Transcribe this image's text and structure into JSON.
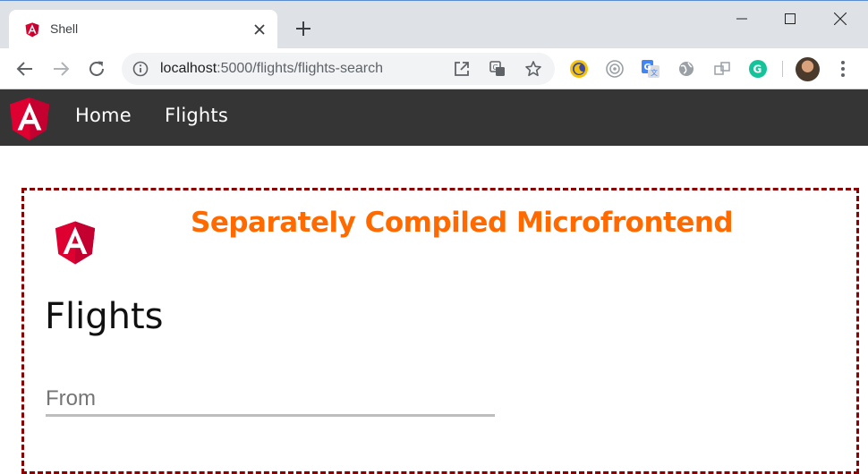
{
  "browser": {
    "tab": {
      "title": "Shell",
      "favicon": "angular-icon"
    },
    "new_tab_icon": "plus-icon",
    "window_controls": [
      "minimize-icon",
      "maximize-icon",
      "close-icon"
    ],
    "toolbar": {
      "back_icon": "arrow-left-icon",
      "forward_icon": "arrow-right-icon",
      "reload_icon": "reload-icon"
    },
    "omnibox": {
      "host": "localhost",
      "path": ":5000/flights/flights-search",
      "icons": [
        "open-external-icon",
        "translate-icon",
        "star-icon"
      ]
    },
    "extensions": [
      "moon-extension-icon",
      "target-extension-icon",
      "google-translate-icon",
      "globe-icon",
      "puzzle-icon",
      "grammarly-icon"
    ]
  },
  "app": {
    "nav": {
      "items": [
        {
          "label": "Home"
        },
        {
          "label": "Flights"
        }
      ]
    },
    "microfrontend": {
      "banner": "Separately Compiled Microfrontend",
      "heading": "Flights",
      "from_label": "From"
    },
    "colors": {
      "appbar": "#353535",
      "banner": "#ff6a00",
      "border": "#8b0000",
      "angular_red": "#dd0031"
    }
  }
}
